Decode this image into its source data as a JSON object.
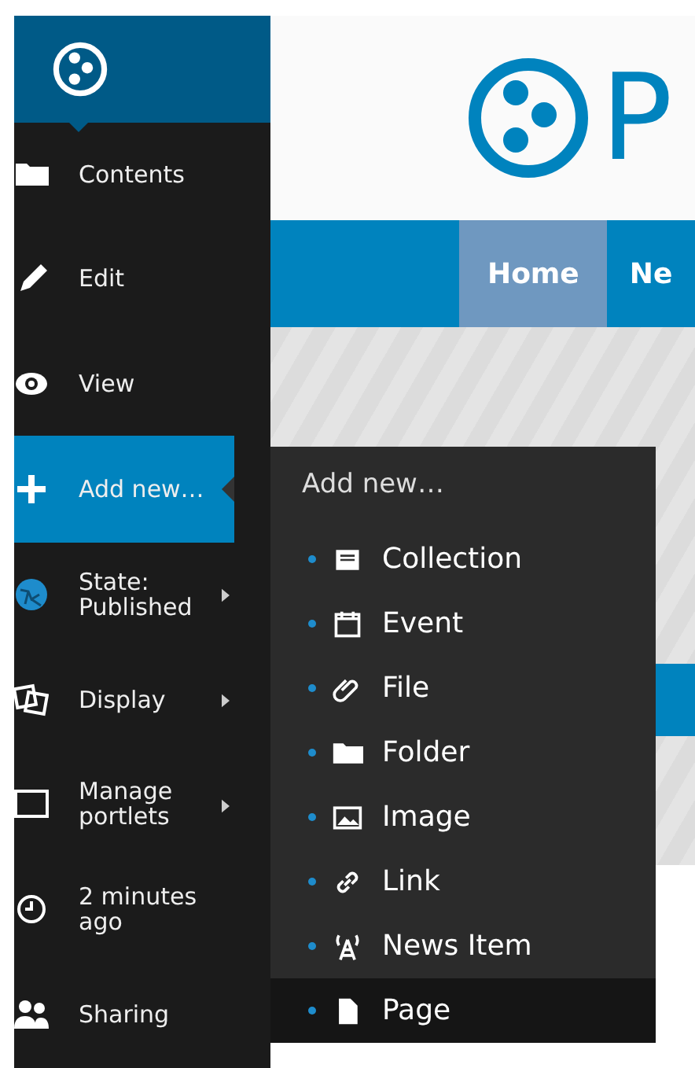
{
  "toolbar": {
    "items": [
      {
        "label": "Contents",
        "kind": "folder",
        "selected": false,
        "submenu": false
      },
      {
        "label": "Edit",
        "kind": "pencil",
        "selected": false,
        "submenu": false
      },
      {
        "label": "View",
        "kind": "eye",
        "selected": false,
        "submenu": false
      },
      {
        "label": "Add new…",
        "kind": "plus",
        "selected": true,
        "submenu": false
      },
      {
        "label": "State: Published",
        "kind": "globe",
        "selected": false,
        "submenu": true
      },
      {
        "label": "Display",
        "kind": "squares",
        "selected": false,
        "submenu": true
      },
      {
        "label": "Manage portlets",
        "kind": "frame",
        "selected": false,
        "submenu": true
      },
      {
        "label": "2 minutes ago",
        "kind": "clock",
        "selected": false,
        "submenu": false
      },
      {
        "label": "Sharing",
        "kind": "people",
        "selected": false,
        "submenu": false
      }
    ]
  },
  "add_menu": {
    "title": "Add new…",
    "items": [
      {
        "label": "Collection",
        "kind": "collection",
        "selected": false
      },
      {
        "label": "Event",
        "kind": "calendar",
        "selected": false
      },
      {
        "label": "File",
        "kind": "paperclip",
        "selected": false
      },
      {
        "label": "Folder",
        "kind": "folder",
        "selected": false
      },
      {
        "label": "Image",
        "kind": "image",
        "selected": false
      },
      {
        "label": "Link",
        "kind": "link",
        "selected": false
      },
      {
        "label": "News Item",
        "kind": "antenna",
        "selected": false
      },
      {
        "label": "Page",
        "kind": "page",
        "selected": true
      }
    ]
  },
  "site": {
    "logo_text": "P",
    "nav": [
      {
        "label": "Home",
        "selected": true
      },
      {
        "label": "Ne",
        "selected": false
      }
    ]
  }
}
